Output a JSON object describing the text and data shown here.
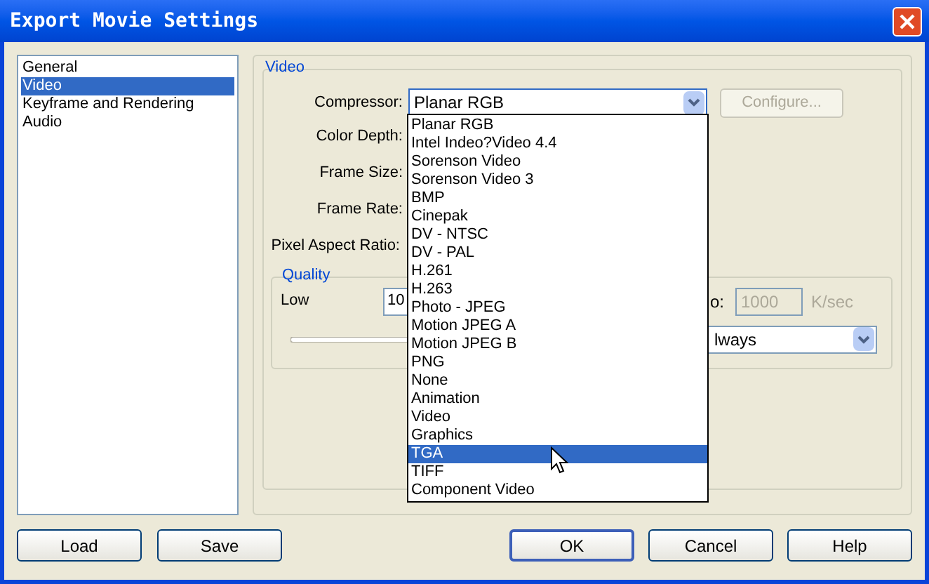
{
  "window": {
    "title": "Export Movie Settings"
  },
  "categories": [
    {
      "label": "General",
      "selected": false
    },
    {
      "label": "Video",
      "selected": true
    },
    {
      "label": "Keyframe and Rendering",
      "selected": false
    },
    {
      "label": "Audio",
      "selected": false
    }
  ],
  "video": {
    "title": "Video",
    "compressor": {
      "label": "Compressor:",
      "value": "Planar RGB",
      "expanded": true
    },
    "configure_button": {
      "label": "Configure...",
      "disabled": true
    },
    "labels": [
      "Color Depth:",
      "Frame Size:",
      "Frame Rate:",
      "Pixel Aspect Ratio:"
    ],
    "quality": {
      "title": "Quality",
      "low_label": "Low",
      "quality_field": "10",
      "data_rate_label": "o:",
      "data_rate_field": {
        "value": "1000",
        "disabled": true
      },
      "data_rate_unit": "K/sec",
      "recompress_select": "lways"
    },
    "compressor_options": [
      {
        "label": "Planar RGB",
        "selected": false
      },
      {
        "label": "Intel Indeo?Video 4.4",
        "selected": false
      },
      {
        "label": "Sorenson Video",
        "selected": false
      },
      {
        "label": "Sorenson Video 3",
        "selected": false
      },
      {
        "label": "BMP",
        "selected": false
      },
      {
        "label": "Cinepak",
        "selected": false
      },
      {
        "label": "DV - NTSC",
        "selected": false
      },
      {
        "label": "DV - PAL",
        "selected": false
      },
      {
        "label": "H.261",
        "selected": false
      },
      {
        "label": "H.263",
        "selected": false
      },
      {
        "label": "Photo - JPEG",
        "selected": false
      },
      {
        "label": "Motion JPEG A",
        "selected": false
      },
      {
        "label": "Motion JPEG B",
        "selected": false
      },
      {
        "label": "PNG",
        "selected": false
      },
      {
        "label": "None",
        "selected": false
      },
      {
        "label": "Animation",
        "selected": false
      },
      {
        "label": "Video",
        "selected": false
      },
      {
        "label": "Graphics",
        "selected": false
      },
      {
        "label": "TGA",
        "selected": true
      },
      {
        "label": "TIFF",
        "selected": false
      },
      {
        "label": "Component Video",
        "selected": false
      }
    ]
  },
  "buttons": [
    {
      "label": "Load",
      "default": false
    },
    {
      "label": "Save",
      "default": false
    },
    {
      "label": "OK",
      "default": true
    },
    {
      "label": "Cancel",
      "default": false
    },
    {
      "label": "Help",
      "default": false
    }
  ]
}
